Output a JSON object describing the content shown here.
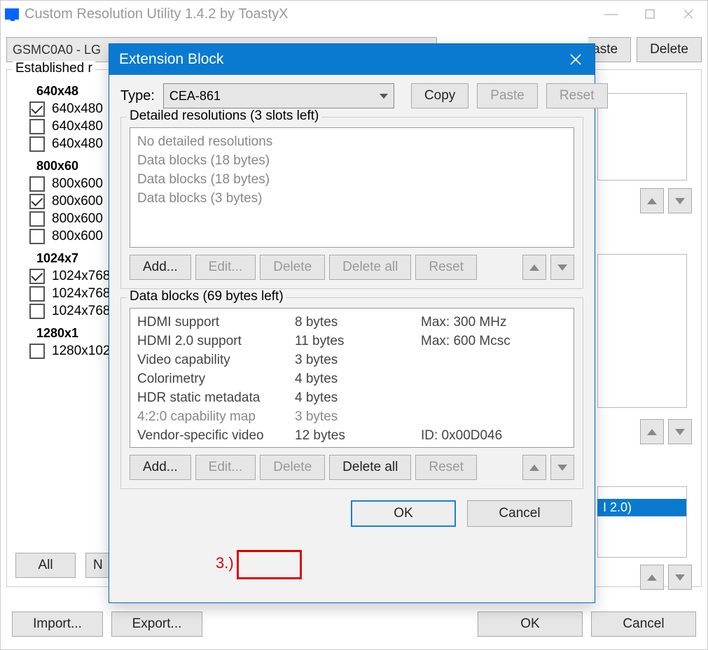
{
  "window": {
    "title": "Custom Resolution Utility 1.4.2 by ToastyX",
    "minimize": "—",
    "close": "✕"
  },
  "main": {
    "display_combo": "GSMC0A0 - LG",
    "paste": "aste",
    "delete": "Delete",
    "group_legend": "Established r",
    "res_groups": [
      {
        "head": "640x48",
        "items": [
          {
            "label": "640x480",
            "checked": true
          },
          {
            "label": "640x480",
            "checked": false
          },
          {
            "label": "640x480",
            "checked": false
          }
        ]
      },
      {
        "head": "800x60",
        "items": [
          {
            "label": "800x600",
            "checked": false
          },
          {
            "label": "800x600",
            "checked": true
          },
          {
            "label": "800x600",
            "checked": false
          },
          {
            "label": "800x600",
            "checked": false
          }
        ]
      },
      {
        "head": "1024x7",
        "items": [
          {
            "label": "1024x768",
            "checked": true
          },
          {
            "label": "1024x768",
            "checked": false
          },
          {
            "label": "1024x768",
            "checked": false
          }
        ]
      },
      {
        "head": "1280x1",
        "items": [
          {
            "label": "1280x102",
            "checked": false
          }
        ]
      }
    ],
    "all": "All",
    "n": "N",
    "import": "Import...",
    "export": "Export...",
    "ok": "OK",
    "cancel": "Cancel",
    "sel_item": "I 2.0)"
  },
  "dlg": {
    "title": "Extension Block",
    "type_label": "Type:",
    "type_value": "CEA-861",
    "copy": "Copy",
    "paste": "Paste",
    "reset": "Reset",
    "detailed": {
      "legend": "Detailed resolutions (3 slots left)",
      "items": [
        "No detailed resolutions",
        "Data blocks (18 bytes)",
        "Data blocks (18 bytes)",
        "Data blocks (3 bytes)"
      ],
      "add": "Add...",
      "edit": "Edit...",
      "delete": "Delete",
      "delete_all": "Delete all",
      "reset": "Reset"
    },
    "datablocks": {
      "legend": "Data blocks (69 bytes left)",
      "rows": [
        {
          "c1": "HDMI support",
          "c2": "8 bytes",
          "c3": "Max: 300 MHz",
          "gray": false
        },
        {
          "c1": "HDMI 2.0 support",
          "c2": "11 bytes",
          "c3": "Max: 600 Mcsc",
          "gray": false
        },
        {
          "c1": "Video capability",
          "c2": "3 bytes",
          "c3": "",
          "gray": false
        },
        {
          "c1": "Colorimetry",
          "c2": "4 bytes",
          "c3": "",
          "gray": false
        },
        {
          "c1": "HDR static metadata",
          "c2": "4 bytes",
          "c3": "",
          "gray": false
        },
        {
          "c1": "4:2:0 capability map",
          "c2": "3 bytes",
          "c3": "",
          "gray": true
        },
        {
          "c1": "Vendor-specific video",
          "c2": "12 bytes",
          "c3": "ID: 0x00D046",
          "gray": false
        }
      ],
      "add": "Add...",
      "edit": "Edit...",
      "delete": "Delete",
      "delete_all": "Delete all",
      "reset": "Reset"
    },
    "ok": "OK",
    "cancel": "Cancel"
  },
  "annot": {
    "step": "3.)"
  }
}
